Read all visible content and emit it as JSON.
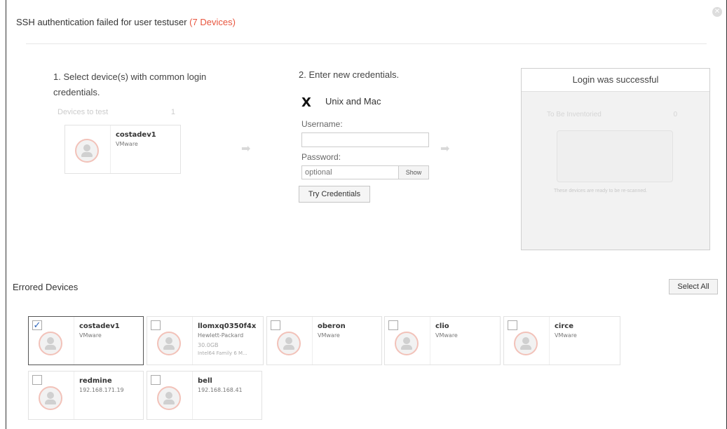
{
  "dialog": {
    "title": "SSH authentication failed for user testuser",
    "count": "(7 Devices)"
  },
  "step1": {
    "heading": "1. Select device(s) with common login credentials.",
    "devices_to_test_label": "Devices to test",
    "devices_to_test_count": "1",
    "device": {
      "name": "costadev1",
      "vendor": "VMware"
    }
  },
  "step2": {
    "heading": "2. Enter new credentials.",
    "os_logo": "X",
    "os_label": "Unix and Mac",
    "username_label": "Username:",
    "username_value": "",
    "password_label": "Password:",
    "password_placeholder": "optional",
    "show_label": "Show",
    "try_label": "Try Credentials"
  },
  "result": {
    "heading": "Login was successful",
    "to_be_inventoried_label": "To Be Inventoried",
    "to_be_inventoried_count": "0",
    "note": "These devices are ready to be re-scanned."
  },
  "errored": {
    "heading": "Errored Devices",
    "select_all_label": "Select All",
    "devices": [
      {
        "name": "costadev1",
        "sub": "VMware",
        "sub2": "",
        "sub3": "",
        "checked": true
      },
      {
        "name": "llomxq0350f4x",
        "sub": "Hewlett-Packard",
        "sub2": "30.0GB",
        "sub3": "Intel64 Family 6 M...",
        "checked": false
      },
      {
        "name": "oberon",
        "sub": "VMware",
        "sub2": "",
        "sub3": "",
        "checked": false
      },
      {
        "name": "clio",
        "sub": "VMware",
        "sub2": "",
        "sub3": "",
        "checked": false
      },
      {
        "name": "circe",
        "sub": "VMware",
        "sub2": "",
        "sub3": "",
        "checked": false
      },
      {
        "name": "redmine",
        "sub": "192.168.171.19",
        "sub2": "",
        "sub3": "",
        "checked": false
      },
      {
        "name": "bell",
        "sub": "192.168.168.41",
        "sub2": "",
        "sub3": "",
        "checked": false
      }
    ]
  },
  "colors": {
    "accent": "#e8553e",
    "check": "#2a62b8"
  }
}
